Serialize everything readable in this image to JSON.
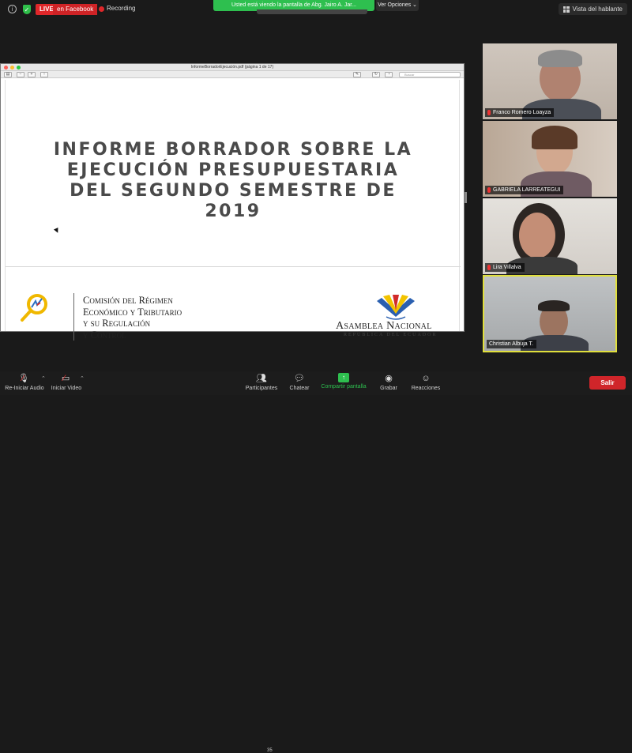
{
  "topbar": {
    "live_label": "LIVE",
    "facebook_label": "en Facebook",
    "recording_label": "Recording",
    "share_banner": "Usted está viendo la pantalla de Abg. Jairo A. Jar...",
    "options_label": "Ver Opciones",
    "speaker_view_label": "Vista del hablante"
  },
  "pdf": {
    "window_title": "InformeBorradorEjecución.pdf (página 1 de 17)",
    "search_placeholder": "Buscar",
    "doc_title_lines": [
      "INFORME BORRADOR SOBRE LA",
      "EJECUCIÓN PRESUPUESTARIA",
      "DEL SEGUNDO SEMESTRE DE",
      "2019"
    ],
    "comision_lines": [
      "Comisión del Régimen",
      "Económico y Tributario",
      "y su Regulación",
      "y Control"
    ],
    "asamblea": "Asamblea Nacional",
    "republica": "REPÚBLICA DEL ECUADOR"
  },
  "participants": [
    {
      "name": "Franco Romero Loayza"
    },
    {
      "name": "GABRIELA LARREATEGUI"
    },
    {
      "name": "Lira Villalva"
    },
    {
      "name": "Christian Albuja T."
    }
  ],
  "toolbar": {
    "audio_label": "Re-Iniciar Audio",
    "video_label": "Iniciar Video",
    "participants_label": "Participantes",
    "participants_count": "35",
    "chat_label": "Chatear",
    "share_label": "Compartir pantalla",
    "record_label": "Grabar",
    "reactions_label": "Reacciones",
    "leave_label": "Salir"
  },
  "colors": {
    "live_red": "#e0272a",
    "share_green": "#2ebf4f",
    "active_speaker_border": "#e0df3c",
    "leave_red": "#d0252a"
  }
}
